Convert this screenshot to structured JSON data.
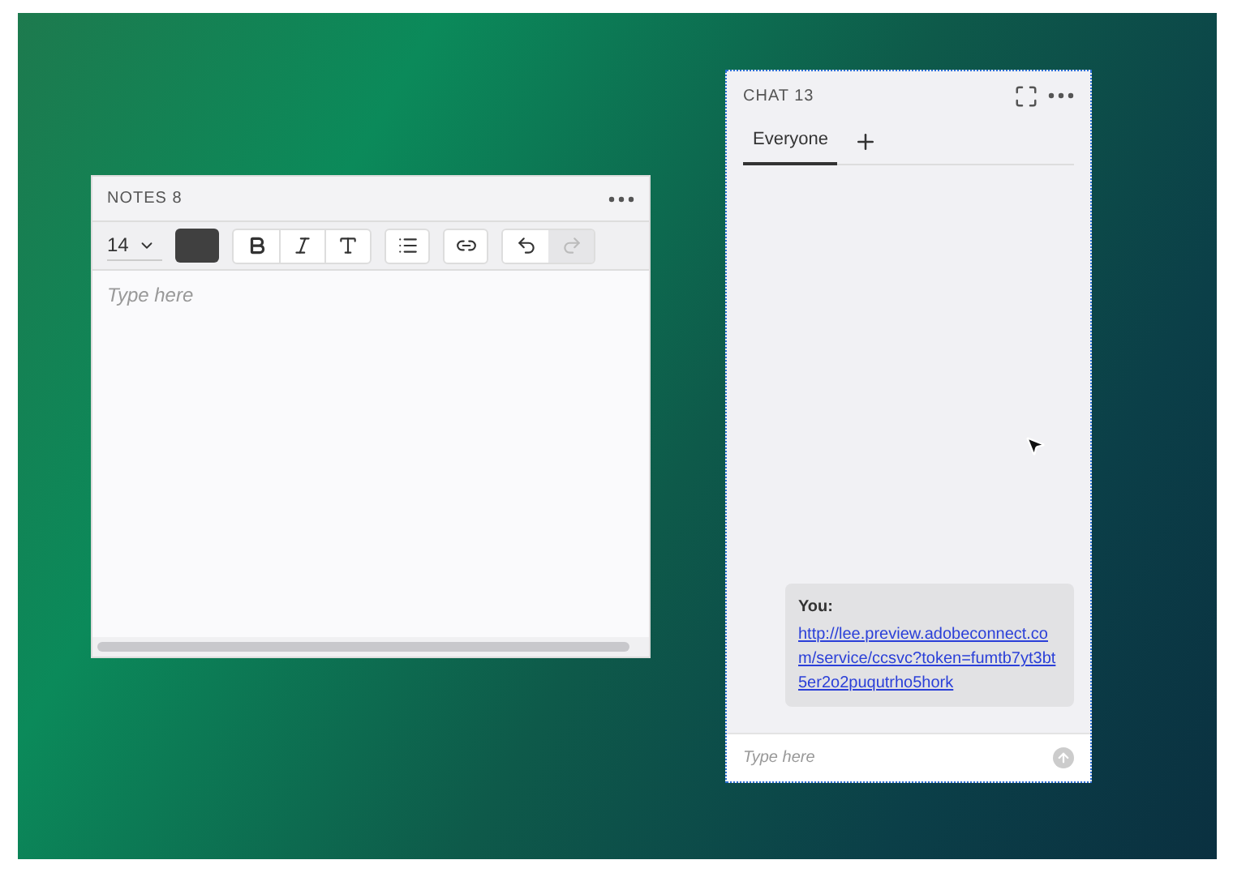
{
  "notes": {
    "title": "NOTES 8",
    "font_size": "14",
    "swatch": {
      "color": "#404040"
    },
    "placeholder": "Type here",
    "history": [
      {
        "kind": "undo",
        "disabled": false
      },
      {
        "kind": "redo",
        "disabled": true
      }
    ]
  },
  "chat": {
    "title": "CHAT 13",
    "tabs": [
      {
        "label": "Everyone",
        "selected": true
      }
    ],
    "messages": [
      {
        "sender": "You:",
        "link": "http://lee.preview.adobeconnect.com/service/ccsvc?token=fumtb7yt3bt5er2o2puqutrho5hork"
      }
    ],
    "input": {
      "placeholder": "Type here"
    }
  }
}
